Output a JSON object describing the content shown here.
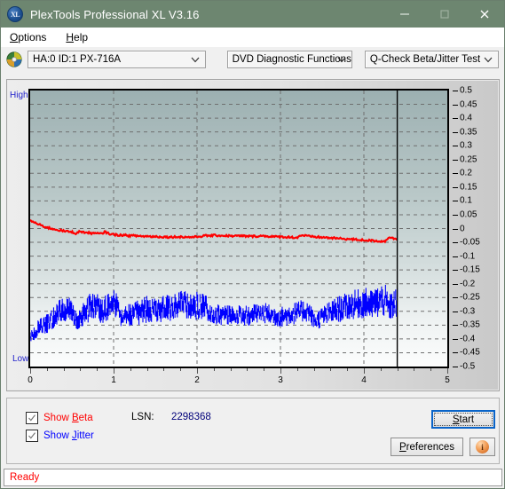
{
  "window": {
    "title": "PlexTools Professional XL V3.16",
    "icon": "XL",
    "titlebar_color": "#6d8670",
    "minimize_label": "–",
    "maximize_label": "□",
    "close_label": "×"
  },
  "menubar": {
    "items": [
      {
        "label": "Options",
        "accel": "O"
      },
      {
        "label": "Help",
        "accel": "H"
      }
    ]
  },
  "toolbar": {
    "drive_icon": "disc-icon",
    "drive_select": "HA:0 ID:1  PX-716A",
    "function_select": "DVD Diagnostic Functions",
    "test_select": "Q-Check Beta/Jitter Test",
    "chevron": "∨"
  },
  "chart_labels": {
    "high": "High",
    "low": "Low"
  },
  "controls": {
    "show_beta_label": "Show Beta",
    "show_beta_accel": "B",
    "show_beta_checked": true,
    "show_beta_color": "#ff0000",
    "show_jitter_label": "Show Jitter",
    "show_jitter_accel": "J",
    "show_jitter_checked": true,
    "show_jitter_color": "#0000ff",
    "lsn_label": "LSN:",
    "lsn_value": "2298368",
    "start_label": "Start",
    "start_accel": "S",
    "preferences_label": "Preferences",
    "preferences_accel": "P",
    "info_label": "i"
  },
  "statusbar": {
    "text": "Ready",
    "color": "#ff0000"
  },
  "chart_data": {
    "type": "line",
    "title": "Q-Check Beta/Jitter Test",
    "xlabel": "",
    "ylabel": "",
    "xlim": [
      0,
      5
    ],
    "ylim": [
      -0.5,
      0.5
    ],
    "xticks": [
      0,
      1,
      2,
      3,
      4,
      5
    ],
    "yticks": [
      0.5,
      0.45,
      0.4,
      0.35,
      0.3,
      0.25,
      0.2,
      0.15,
      0.1,
      0.05,
      0,
      -0.05,
      -0.1,
      -0.15,
      -0.2,
      -0.25,
      -0.3,
      -0.35,
      -0.4,
      -0.45,
      -0.5
    ],
    "ytick_labels": [
      "0.5",
      "0.45",
      "0.4",
      "0.35",
      "0.3",
      "0.25",
      "0.2",
      "0.15",
      "0.1",
      "0.05",
      "0",
      "-0.05",
      "-0.1",
      "-0.15",
      "-0.2",
      "-0.25",
      "-0.3",
      "-0.35",
      "-0.4",
      "-0.45",
      "-0.5"
    ],
    "grid": true,
    "grid_style": "dashed",
    "grid_color": "#6f6f6f",
    "background_gradient": [
      "#9cb0b1",
      "#fcfdfd"
    ],
    "axis_high_label": "High",
    "axis_low_label": "Low",
    "cursor_x": 4.4,
    "cursor_color": "#000000",
    "data_end_x": 4.4,
    "series": [
      {
        "name": "Beta",
        "color": "#ff0000",
        "x": [
          0.0,
          0.05,
          0.1,
          0.15,
          0.2,
          0.25,
          0.3,
          0.35,
          0.4,
          0.45,
          0.5,
          0.55,
          0.6,
          0.65,
          0.7,
          0.75,
          0.8,
          0.85,
          0.9,
          0.95,
          1.0,
          1.05,
          1.1,
          1.15,
          1.2,
          1.25,
          1.3,
          1.35,
          1.4,
          1.45,
          1.5,
          1.55,
          1.6,
          1.65,
          1.7,
          1.75,
          1.8,
          1.85,
          1.9,
          1.95,
          2.0,
          2.05,
          2.1,
          2.15,
          2.2,
          2.25,
          2.3,
          2.35,
          2.4,
          2.45,
          2.5,
          2.55,
          2.6,
          2.65,
          2.7,
          2.75,
          2.8,
          2.85,
          2.9,
          2.95,
          3.0,
          3.05,
          3.1,
          3.15,
          3.2,
          3.25,
          3.3,
          3.35,
          3.4,
          3.45,
          3.5,
          3.55,
          3.6,
          3.65,
          3.7,
          3.75,
          3.8,
          3.85,
          3.9,
          3.95,
          4.0,
          4.05,
          4.1,
          4.15,
          4.2,
          4.25,
          4.3,
          4.35,
          4.4
        ],
        "y": [
          0.03,
          0.022,
          0.015,
          0.009,
          0.004,
          0.0,
          -0.003,
          -0.006,
          -0.009,
          -0.011,
          -0.012,
          -0.018,
          -0.01,
          -0.014,
          -0.016,
          -0.017,
          -0.018,
          -0.019,
          -0.012,
          -0.019,
          -0.022,
          -0.023,
          -0.024,
          -0.025,
          -0.026,
          -0.026,
          -0.027,
          -0.028,
          -0.028,
          -0.029,
          -0.029,
          -0.03,
          -0.03,
          -0.031,
          -0.031,
          -0.03,
          -0.03,
          -0.031,
          -0.031,
          -0.031,
          -0.03,
          -0.028,
          -0.026,
          -0.026,
          -0.025,
          -0.025,
          -0.026,
          -0.026,
          -0.027,
          -0.027,
          -0.027,
          -0.027,
          -0.028,
          -0.028,
          -0.028,
          -0.027,
          -0.027,
          -0.028,
          -0.029,
          -0.03,
          -0.03,
          -0.031,
          -0.031,
          -0.032,
          -0.033,
          -0.024,
          -0.026,
          -0.029,
          -0.03,
          -0.031,
          -0.032,
          -0.033,
          -0.034,
          -0.035,
          -0.036,
          -0.037,
          -0.038,
          -0.039,
          -0.04,
          -0.041,
          -0.042,
          -0.043,
          -0.044,
          -0.045,
          -0.046,
          -0.047,
          -0.03,
          -0.036,
          -0.038
        ]
      },
      {
        "name": "Jitter",
        "color": "#0000ff",
        "note": "noisy band; values below are band centers with +/- spread",
        "x": [
          0.0,
          0.05,
          0.1,
          0.15,
          0.2,
          0.25,
          0.3,
          0.35,
          0.4,
          0.45,
          0.5,
          0.55,
          0.6,
          0.65,
          0.7,
          0.75,
          0.8,
          0.85,
          0.9,
          0.95,
          1.0,
          1.05,
          1.1,
          1.15,
          1.2,
          1.25,
          1.3,
          1.35,
          1.4,
          1.45,
          1.5,
          1.55,
          1.6,
          1.65,
          1.7,
          1.75,
          1.8,
          1.85,
          1.9,
          1.95,
          2.0,
          2.05,
          2.1,
          2.15,
          2.2,
          2.25,
          2.3,
          2.35,
          2.4,
          2.45,
          2.5,
          2.55,
          2.6,
          2.65,
          2.7,
          2.75,
          2.8,
          2.85,
          2.9,
          2.95,
          3.0,
          3.05,
          3.1,
          3.15,
          3.2,
          3.25,
          3.3,
          3.35,
          3.4,
          3.45,
          3.5,
          3.55,
          3.6,
          3.65,
          3.7,
          3.75,
          3.8,
          3.85,
          3.9,
          3.95,
          4.0,
          4.05,
          4.1,
          4.15,
          4.2,
          4.25,
          4.3,
          4.35,
          4.4
        ],
        "y": [
          -0.4,
          -0.38,
          -0.36,
          -0.35,
          -0.345,
          -0.33,
          -0.318,
          -0.3,
          -0.292,
          -0.288,
          -0.3,
          -0.33,
          -0.32,
          -0.3,
          -0.29,
          -0.282,
          -0.278,
          -0.3,
          -0.29,
          -0.278,
          -0.272,
          -0.285,
          -0.33,
          -0.32,
          -0.31,
          -0.305,
          -0.3,
          -0.298,
          -0.295,
          -0.292,
          -0.3,
          -0.295,
          -0.288,
          -0.285,
          -0.282,
          -0.28,
          -0.278,
          -0.276,
          -0.282,
          -0.288,
          -0.28,
          -0.278,
          -0.285,
          -0.3,
          -0.308,
          -0.312,
          -0.315,
          -0.312,
          -0.31,
          -0.312,
          -0.315,
          -0.318,
          -0.315,
          -0.312,
          -0.31,
          -0.308,
          -0.305,
          -0.31,
          -0.315,
          -0.318,
          -0.32,
          -0.318,
          -0.312,
          -0.308,
          -0.305,
          -0.3,
          -0.298,
          -0.302,
          -0.335,
          -0.33,
          -0.32,
          -0.312,
          -0.305,
          -0.298,
          -0.292,
          -0.288,
          -0.282,
          -0.278,
          -0.275,
          -0.272,
          -0.27,
          -0.272,
          -0.278,
          -0.268,
          -0.262,
          -0.258,
          -0.29,
          -0.275,
          -0.268
        ],
        "spread": [
          0.018,
          0.02,
          0.022,
          0.024,
          0.026,
          0.028,
          0.03,
          0.032,
          0.034,
          0.034,
          0.03,
          0.028,
          0.032,
          0.036,
          0.038,
          0.038,
          0.038,
          0.034,
          0.036,
          0.038,
          0.04,
          0.036,
          0.026,
          0.03,
          0.032,
          0.034,
          0.036,
          0.038,
          0.038,
          0.038,
          0.034,
          0.036,
          0.038,
          0.038,
          0.038,
          0.038,
          0.038,
          0.038,
          0.036,
          0.034,
          0.038,
          0.038,
          0.034,
          0.03,
          0.028,
          0.028,
          0.028,
          0.028,
          0.028,
          0.028,
          0.028,
          0.028,
          0.028,
          0.028,
          0.028,
          0.028,
          0.028,
          0.028,
          0.028,
          0.028,
          0.028,
          0.028,
          0.03,
          0.03,
          0.03,
          0.03,
          0.03,
          0.028,
          0.024,
          0.026,
          0.028,
          0.03,
          0.032,
          0.034,
          0.036,
          0.036,
          0.038,
          0.038,
          0.04,
          0.04,
          0.042,
          0.042,
          0.04,
          0.044,
          0.046,
          0.046,
          0.036,
          0.04,
          0.042
        ]
      }
    ]
  }
}
